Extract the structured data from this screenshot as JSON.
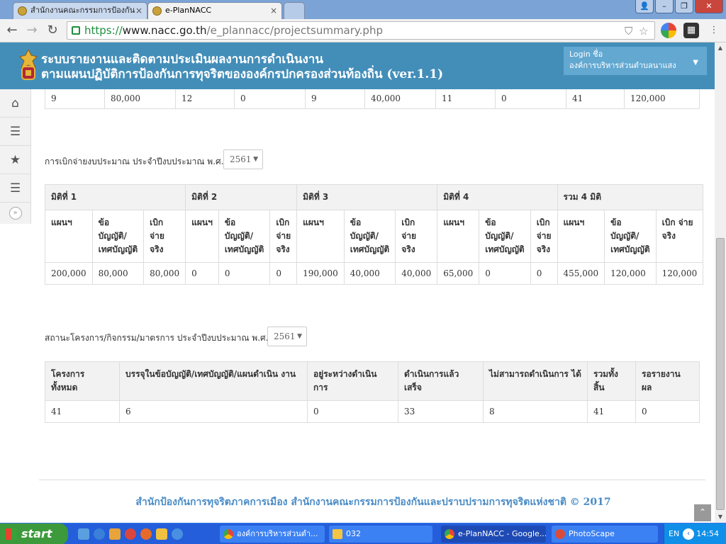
{
  "browser": {
    "tabs": [
      {
        "title": "สำนักงานคณะกรรมการป้องกัน",
        "close": "×"
      },
      {
        "title": "e-PlanNACC",
        "close": "×"
      }
    ],
    "window_buttons": [
      "👤",
      "–",
      "❐",
      "✕"
    ],
    "url_scheme": "https://",
    "url_host": "www.nacc.go.th",
    "url_path": "/e_plannacc/projectsummary.php"
  },
  "header": {
    "title_line1": "ระบบรายงานและติดตามประเมินผลงานการดำเนินงาน",
    "title_line2": "ตามแผนปฏิบัติการป้องกันการทุจริตขององค์กรปกครองส่วนท้องถิ่น (ver.1.1)",
    "login_label": "Login ชื่อ",
    "login_org": "องค์การบริหารส่วนตำบลนาแสง"
  },
  "top_table_row": [
    "9",
    "80,000",
    "12",
    "0",
    "9",
    "40,000",
    "11",
    "0",
    "41",
    "120,000"
  ],
  "budget": {
    "label": "การเบิกจ่ายงบประมาณ ประจำปีงบประมาณ พ.ศ.",
    "year": "2561",
    "groups": [
      "มิติที่ 1",
      "มิติที่ 2",
      "มิติที่ 3",
      "มิติที่ 4",
      "รวม 4 มิติ"
    ],
    "subheaders": [
      "แผนฯ",
      "ข้อบัญญัติ/ เทศบัญญัติ",
      "เบิก จ่าย จริง"
    ],
    "row": [
      "200,000",
      "80,000",
      "80,000",
      "0",
      "0",
      "0",
      "190,000",
      "40,000",
      "40,000",
      "65,000",
      "0",
      "0",
      "455,000",
      "120,000",
      "120,000"
    ]
  },
  "status": {
    "label": "สถานะโครงการ/กิจกรรม/มาตรการ ประจำปีงบประมาณ พ.ศ.",
    "year": "2561",
    "headers": [
      "โครงการ ทั้งหมด",
      "บรรจุในข้อบัญญัติ/เทศบัญญัติ/แผนดำเนิน งาน",
      "อยู่ระหว่างดำเนิน การ",
      "ดำเนินการแล้ว เสร็จ",
      "ไม่สามารถดำเนินการ ได้",
      "รวมทั้ง สิ้น",
      "รอรายงาน ผล"
    ],
    "row": [
      "41",
      "6",
      "0",
      "33",
      "8",
      "41",
      "0"
    ]
  },
  "footer": "สำนักป้องกันการทุจริตภาคการเมือง สำนักงานคณะกรรมการป้องกันและปราบปรามการทุจริตแห่งชาติ © 2017",
  "taskbar": {
    "start": "start",
    "windows": [
      {
        "title": "องค์การบริหารส่วนตำ...",
        "color": "#e8b23a"
      },
      {
        "title": "032",
        "color": "#f4c542"
      },
      {
        "title": "e-PlanNACC - Google...",
        "color": "#e8b23a"
      },
      {
        "title": "PhotoScape",
        "color": "#d94c3c"
      }
    ],
    "lang": "EN",
    "clock": "14:54"
  }
}
